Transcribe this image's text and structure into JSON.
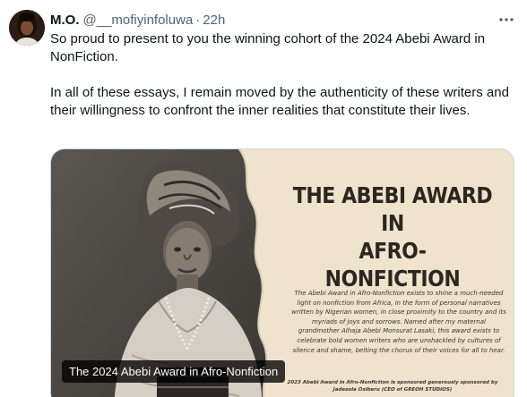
{
  "user": {
    "display_name": "M.O.",
    "handle": "@__mofiyinfoluwa",
    "separator": "·",
    "time": "22h",
    "avatar_icon": "user-avatar"
  },
  "tweet": {
    "paragraph_1": "So proud to present to you the winning cohort of the 2024 Abebi Award in NonFiction.",
    "paragraph_2": "In all of these essays, I remain moved by the authenticity of these writers and their willingness to confront the inner realities that constitute their lives."
  },
  "media": {
    "alt_label": "The 2024 Abebi Award in Afro-Nonfiction",
    "poster": {
      "title_line_1": "THE ABEBI AWARD",
      "title_line_2": "IN",
      "title_line_3": "AFRO-NONFICTION",
      "description": "The Abebi Award in Afro-Nonfiction exists to shine a much-needed light on nonfiction from Africa, in the form of personal narratives written by Nigerian women, in close proximity to the country and its myriads of joys and sorrows. Named after my maternal grandmother Alhaja Abebi Monsurat Lasaki, this award exists to celebrate bold women writers who are unshackled by cultures of silence and shame, belting the chorus of their voices for all to hear.",
      "sponsor": "2023 Abebi Award in Afro-Nonfiction is sponsored generously sponsored by Jadesola Osiberu (CEO of GREOH STUDIOS)"
    }
  },
  "icons": {
    "more": "more-options-icon"
  },
  "colors": {
    "text": "#0f1419",
    "secondary": "#536471",
    "poster_bg": "#efe3cd",
    "poster_text": "#2d2620"
  }
}
